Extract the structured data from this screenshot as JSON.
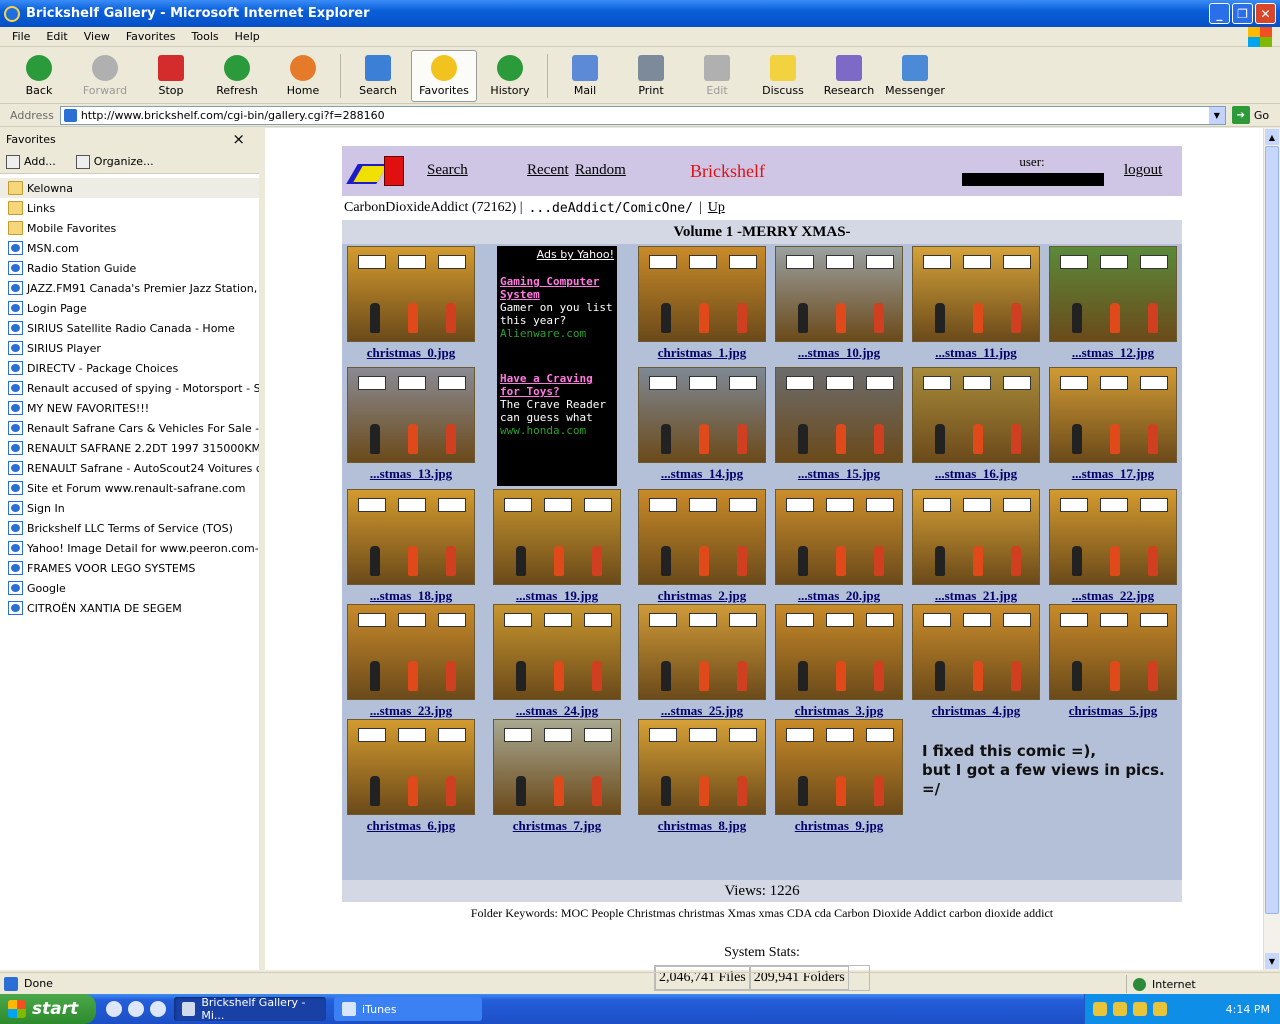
{
  "window": {
    "title": "Brickshelf Gallery - Microsoft Internet Explorer"
  },
  "menu": [
    "File",
    "Edit",
    "View",
    "Favorites",
    "Tools",
    "Help"
  ],
  "toolbar": [
    {
      "label": "Back",
      "icon": "back-arrow-icon",
      "color": "#2b9a3a",
      "enabled": true
    },
    {
      "label": "Forward",
      "icon": "forward-arrow-icon",
      "color": "#b0b0b0",
      "enabled": false
    },
    {
      "label": "Stop",
      "icon": "stop-icon",
      "color": "#d42c2c",
      "enabled": true
    },
    {
      "label": "Refresh",
      "icon": "refresh-icon",
      "color": "#2b9a3a",
      "enabled": true
    },
    {
      "label": "Home",
      "icon": "home-icon",
      "color": "#e57b2a",
      "enabled": true
    },
    {
      "label": "Search",
      "icon": "search-icon",
      "color": "#3b7fd6",
      "enabled": true
    },
    {
      "label": "Favorites",
      "icon": "star-icon",
      "color": "#f2c21e",
      "enabled": true,
      "active": true
    },
    {
      "label": "History",
      "icon": "history-icon",
      "color": "#2b9a3a",
      "enabled": true
    },
    {
      "label": "Mail",
      "icon": "mail-icon",
      "color": "#5c8ad6",
      "enabled": true
    },
    {
      "label": "Print",
      "icon": "printer-icon",
      "color": "#7d8a99",
      "enabled": true
    },
    {
      "label": "Edit",
      "icon": "edit-icon",
      "color": "#b0b0b0",
      "enabled": false
    },
    {
      "label": "Discuss",
      "icon": "discuss-icon",
      "color": "#f2d23e",
      "enabled": true
    },
    {
      "label": "Research",
      "icon": "research-icon",
      "color": "#7d6ac6",
      "enabled": true
    },
    {
      "label": "Messenger",
      "icon": "messenger-icon",
      "color": "#4a8ad6",
      "enabled": true
    }
  ],
  "address": {
    "label": "Address",
    "url": "http://www.brickshelf.com/cgi-bin/gallery.cgi?f=288160",
    "go": "Go"
  },
  "favorites": {
    "title": "Favorites",
    "close": "×",
    "add": "Add...",
    "organize": "Organize...",
    "items": [
      {
        "label": "Kelowna",
        "type": "folder"
      },
      {
        "label": "Links",
        "type": "folder"
      },
      {
        "label": "Mobile Favorites",
        "type": "folder"
      },
      {
        "label": "MSN.com",
        "type": "page"
      },
      {
        "label": "Radio Station Guide",
        "type": "page"
      },
      {
        "label": "JAZZ.FM91 Canada's Premier Jazz Station, T...",
        "type": "page"
      },
      {
        "label": "Login Page",
        "type": "page"
      },
      {
        "label": "SIRIUS Satellite Radio Canada - Home",
        "type": "page"
      },
      {
        "label": "SIRIUS Player",
        "type": "page"
      },
      {
        "label": "DIRECTV - Package Choices",
        "type": "page"
      },
      {
        "label": "Renault accused of spying - Motorsport - Spo...",
        "type": "page"
      },
      {
        "label": "MY NEW FAVORITES!!!",
        "type": "page"
      },
      {
        "label": "Renault Safrane Cars & Vehicles For Sale - S...",
        "type": "page"
      },
      {
        "label": "RENAULT SAFRANE 2.2DT 1997 315000KMS",
        "type": "page"
      },
      {
        "label": "RENAULT Safrane - AutoScout24 Voitures d'o...",
        "type": "page"
      },
      {
        "label": "Site et Forum www.renault-safrane.com",
        "type": "page"
      },
      {
        "label": "Sign In",
        "type": "page"
      },
      {
        "label": "Brickshelf LLC Terms of Service (TOS)",
        "type": "page"
      },
      {
        "label": "Yahoo! Image Detail for www.peeron.com-pi...",
        "type": "page"
      },
      {
        "label": "FRAMES VOOR LEGO SYSTEMS",
        "type": "page"
      },
      {
        "label": "Google",
        "type": "page"
      },
      {
        "label": "CITROËN XANTIA DE SEGEM",
        "type": "page"
      }
    ]
  },
  "site": {
    "nav": {
      "search": "Search",
      "recent": "Recent",
      "random": "Random",
      "brand": "Brickshelf",
      "user_label": "user:",
      "logout": "logout"
    },
    "breadcrumb": {
      "owner": "CarbonDioxideAddict (72162) |",
      "path": "...deAddict/ComicOne/",
      "sep": "|",
      "up": "Up"
    },
    "volume_title": "Volume 1 -MERRY XMAS-",
    "ad": {
      "header": "Ads by Yahoo!",
      "ads": [
        {
          "title": "Gaming Computer System",
          "body": "Gamer on you list this year?",
          "url": "Alienware.com"
        },
        {
          "title": "Have a Craving for Toys?",
          "body": "The Crave Reader can guess what",
          "url": "www.honda.com"
        }
      ]
    },
    "thumbs": [
      {
        "caption": "christmas_0.jpg",
        "bg": "#d39a2e"
      },
      {
        "caption": "christmas_1.jpg",
        "bg": "#c98a28"
      },
      {
        "caption": "...stmas_10.jpg",
        "bg": "#9aa0a0"
      },
      {
        "caption": "...stmas_11.jpg",
        "bg": "#d4a23a"
      },
      {
        "caption": "...stmas_12.jpg",
        "bg": "#5a8a3a"
      },
      {
        "caption": "...stmas_13.jpg",
        "bg": "#8a8a92"
      },
      {
        "caption": "...stmas_14.jpg",
        "bg": "#7e8894"
      },
      {
        "caption": "...stmas_15.jpg",
        "bg": "#6c6c6c"
      },
      {
        "caption": "...stmas_16.jpg",
        "bg": "#a88a3a"
      },
      {
        "caption": "...stmas_17.jpg",
        "bg": "#d09a34"
      },
      {
        "caption": "...stmas_18.jpg",
        "bg": "#d39a2e"
      },
      {
        "caption": "...stmas_19.jpg",
        "bg": "#c9962e"
      },
      {
        "caption": "christmas_2.jpg",
        "bg": "#c98a28"
      },
      {
        "caption": "...stmas_20.jpg",
        "bg": "#cc8e2c"
      },
      {
        "caption": "...stmas_21.jpg",
        "bg": "#d6a036"
      },
      {
        "caption": "...stmas_22.jpg",
        "bg": "#d39a2e"
      },
      {
        "caption": "...stmas_23.jpg",
        "bg": "#c88a2a"
      },
      {
        "caption": "...stmas_24.jpg",
        "bg": "#c9962e"
      },
      {
        "caption": "...stmas_25.jpg",
        "bg": "#cf9a38"
      },
      {
        "caption": "christmas_3.jpg",
        "bg": "#c98a28"
      },
      {
        "caption": "christmas_4.jpg",
        "bg": "#cc8e2c"
      },
      {
        "caption": "christmas_5.jpg",
        "bg": "#c98a28"
      },
      {
        "caption": "christmas_6.jpg",
        "bg": "#d39a2e"
      },
      {
        "caption": "christmas_7.jpg",
        "bg": "#a8a890"
      },
      {
        "caption": "christmas_8.jpg",
        "bg": "#d6a036"
      },
      {
        "caption": "christmas_9.jpg",
        "bg": "#c98a28"
      }
    ],
    "note": [
      "I fixed this comic =),",
      "but I got a few views in pics. =/"
    ],
    "views": "Views: 1226",
    "keywords": "Folder Keywords: MOC People Christmas christmas Xmas xmas CDA cda Carbon Dioxide Addict carbon dioxide addict",
    "stats_label": "System Stats:",
    "files": "2,046,741 Files",
    "folders": "209,941 Folders"
  },
  "status": {
    "text": "Done",
    "zone": "Internet"
  },
  "taskbar": {
    "start": "start",
    "tasks": [
      "Brickshelf Gallery - Mi...",
      "iTunes"
    ],
    "clock": "4:14 PM"
  }
}
